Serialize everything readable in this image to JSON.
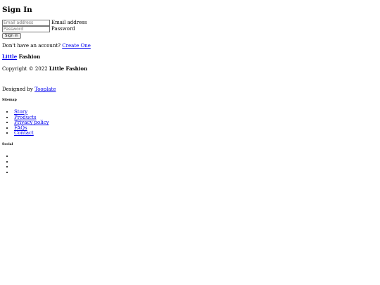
{
  "sign_in": {
    "title": "Sign In",
    "email": {
      "placeholder": "Email address",
      "label": "Email address"
    },
    "password": {
      "placeholder": "Password",
      "label": "Password"
    },
    "submit_label": "Sign in",
    "no_account_text": "Don't have an account?",
    "create_link": "Create One"
  },
  "brand": {
    "link": "Little",
    "rest": "Fashion"
  },
  "footer": {
    "copyright_prefix": "Copyright © 2022",
    "copyright_brand": "Little Fashion",
    "designed_by_prefix": "Designed by",
    "designed_by_link": "Tooplate"
  },
  "sitemap": {
    "title": "Sitemap",
    "items": [
      "Story",
      "Products",
      "Privacy policy",
      "FAQs",
      "Contact"
    ]
  },
  "social": {
    "title": "Social",
    "items": [
      "",
      "",
      "",
      ""
    ]
  }
}
